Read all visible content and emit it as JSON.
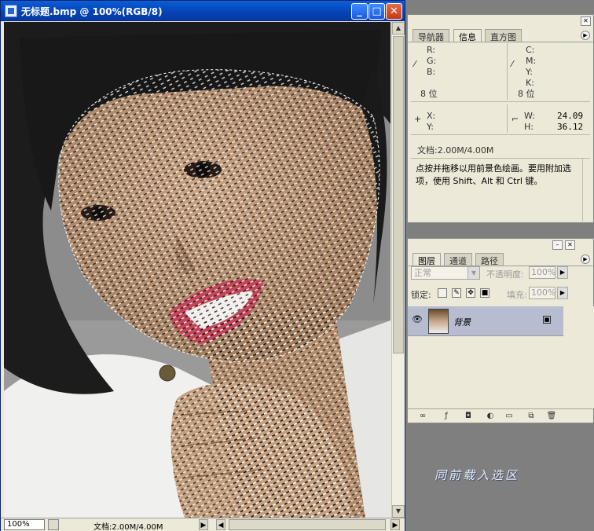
{
  "document": {
    "title": "无标题.bmp @ 100%(RGB/8)",
    "zoom": "100%",
    "doc_size": "文档:2.00M/4.00M"
  },
  "info_panel": {
    "tabs": [
      "导航器",
      "信息",
      "直方图"
    ],
    "active_tab": "信息",
    "rgb_labels": [
      "R:",
      "G:",
      "B:"
    ],
    "cmyk_labels": [
      "C:",
      "M:",
      "Y:",
      "K:"
    ],
    "bit_depth_left": "8 位",
    "bit_depth_right": "8 位",
    "x_label": "X:",
    "y_label": "Y:",
    "w_label": "W:",
    "h_label": "H:",
    "w_value": "24.09",
    "h_value": "36.12",
    "doc_size": "文档:2.00M/4.00M",
    "tip": "点按并拖移以用前景色绘画。要用附加选项，使用 Shift、Alt 和 Ctrl 键。"
  },
  "layers_panel": {
    "tabs": [
      "图层",
      "通道",
      "路径"
    ],
    "active_tab": "图层",
    "blend_mode": "正常",
    "opacity_label": "不透明度:",
    "opacity_value": "100%",
    "lock_label": "锁定:",
    "fill_label": "填充:",
    "fill_value": "100%",
    "layers": [
      {
        "name": "背景",
        "visible": true,
        "locked": true
      }
    ]
  },
  "caption": "同前载入选区",
  "colors": {
    "titlebar": "#0542b5",
    "selected_layer": "#b6bdd1",
    "workspace": "#7f7f7f"
  }
}
